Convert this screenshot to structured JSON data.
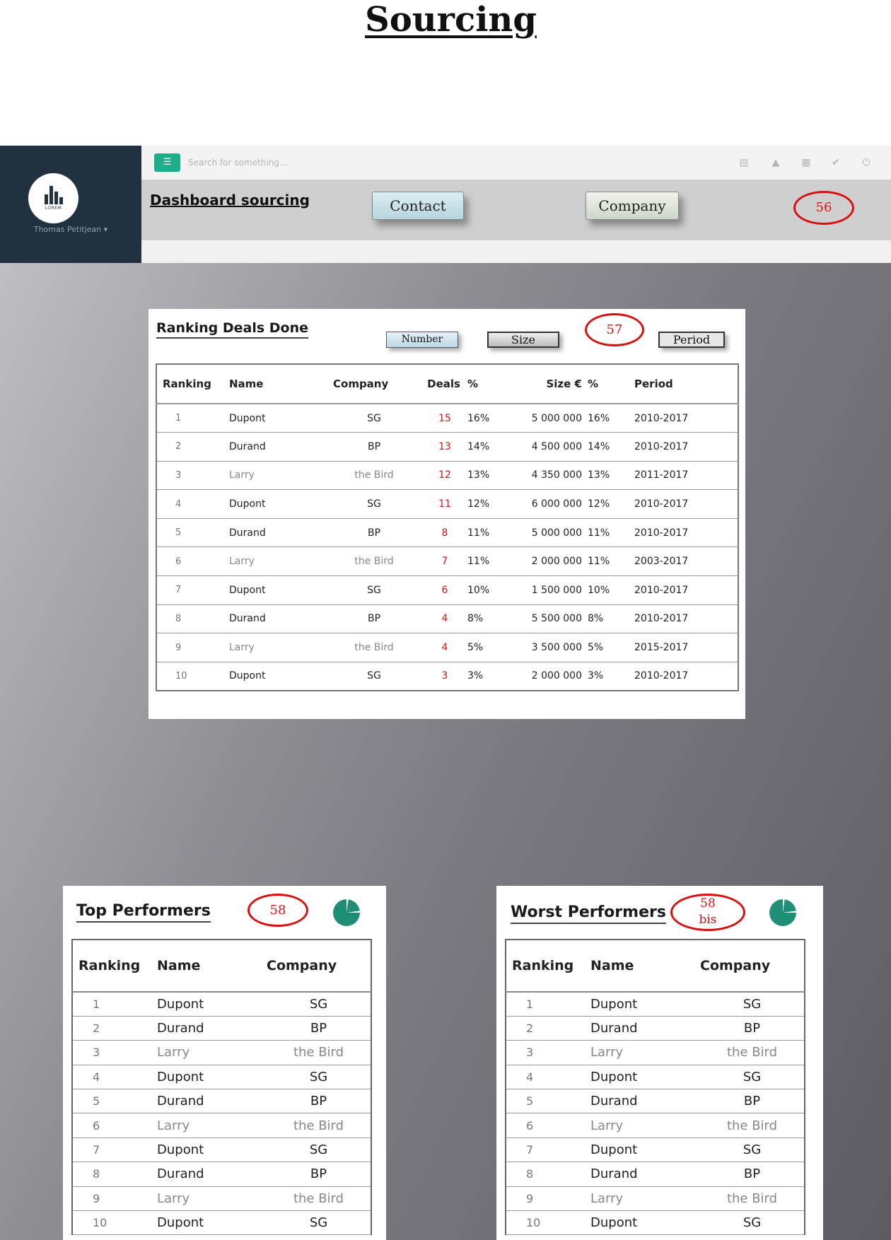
{
  "page_title": "Sourcing",
  "app": {
    "user_name": "Thomas Petitjean ▾",
    "logo_text": "LOREM",
    "search_placeholder": "Search for something...",
    "menu_icon": "hamburger-icon",
    "top_icons": [
      "document-icon",
      "user-icon",
      "calendar-icon",
      "check-icon",
      "power-icon"
    ]
  },
  "header": {
    "title": "Dashboard sourcing",
    "contact_label": "Contact",
    "company_label": "Company",
    "annotation": "56"
  },
  "ranking": {
    "title": "Ranking Deals Done",
    "buttons": {
      "number": "Number",
      "size": "Size",
      "period": "Period"
    },
    "annotation": "57",
    "columns": [
      "Ranking",
      "Name",
      "Company",
      "Deals",
      "%",
      "Size  €",
      "%",
      "Period"
    ],
    "rows": [
      {
        "rank": "1",
        "name": "Dupont",
        "company": "SG",
        "deals": "15",
        "deals_pct": "16%",
        "size": "5 000 000",
        "size_pct": "16%",
        "period": "2010-2017"
      },
      {
        "rank": "2",
        "name": "Durand",
        "company": "BP",
        "deals": "13",
        "deals_pct": "14%",
        "size": "4 500 000",
        "size_pct": "14%",
        "period": "2010-2017"
      },
      {
        "rank": "3",
        "name": "Larry",
        "company": "the Bird",
        "deals": "12",
        "deals_pct": "13%",
        "size": "4 350 000",
        "size_pct": "13%",
        "period": "2011-2017"
      },
      {
        "rank": "4",
        "name": "Dupont",
        "company": "SG",
        "deals": "11",
        "deals_pct": "12%",
        "size": "6 000 000",
        "size_pct": "12%",
        "period": "2010-2017"
      },
      {
        "rank": "5",
        "name": "Durand",
        "company": "BP",
        "deals": "8",
        "deals_pct": "11%",
        "size": "5 000 000",
        "size_pct": "11%",
        "period": "2010-2017"
      },
      {
        "rank": "6",
        "name": "Larry",
        "company": "the Bird",
        "deals": "7",
        "deals_pct": "11%",
        "size": "2 000 000",
        "size_pct": "11%",
        "period": "2003-2017"
      },
      {
        "rank": "7",
        "name": "Dupont",
        "company": "SG",
        "deals": "6",
        "deals_pct": "10%",
        "size": "1 500 000",
        "size_pct": "10%",
        "period": "2010-2017"
      },
      {
        "rank": "8",
        "name": "Durand",
        "company": "BP",
        "deals": "4",
        "deals_pct": "8%",
        "size": "5 500 000",
        "size_pct": "8%",
        "period": "2010-2017"
      },
      {
        "rank": "9",
        "name": "Larry",
        "company": "the Bird",
        "deals": "4",
        "deals_pct": "5%",
        "size": "3 500 000",
        "size_pct": "5%",
        "period": "2015-2017"
      },
      {
        "rank": "10",
        "name": "Dupont",
        "company": "SG",
        "deals": "3",
        "deals_pct": "3%",
        "size": "2 000 000",
        "size_pct": "3%",
        "period": "2010-2017"
      }
    ]
  },
  "top_performers": {
    "title": "Top Performers",
    "annotation": "58",
    "columns": [
      "Ranking",
      "Name",
      "Company"
    ],
    "rows": [
      {
        "rank": "1",
        "name": "Dupont",
        "company": "SG"
      },
      {
        "rank": "2",
        "name": "Durand",
        "company": "BP"
      },
      {
        "rank": "3",
        "name": "Larry",
        "company": "the Bird"
      },
      {
        "rank": "4",
        "name": "Dupont",
        "company": "SG"
      },
      {
        "rank": "5",
        "name": "Durand",
        "company": "BP"
      },
      {
        "rank": "6",
        "name": "Larry",
        "company": "the Bird"
      },
      {
        "rank": "7",
        "name": "Dupont",
        "company": "SG"
      },
      {
        "rank": "8",
        "name": "Durand",
        "company": "BP"
      },
      {
        "rank": "9",
        "name": "Larry",
        "company": "the Bird"
      },
      {
        "rank": "10",
        "name": "Dupont",
        "company": "SG"
      }
    ]
  },
  "worst_performers": {
    "title": "Worst Performers",
    "annotation_line1": "58",
    "annotation_line2": "bis",
    "columns": [
      "Ranking",
      "Name",
      "Company"
    ],
    "rows": [
      {
        "rank": "1",
        "name": "Dupont",
        "company": "SG"
      },
      {
        "rank": "2",
        "name": "Durand",
        "company": "BP"
      },
      {
        "rank": "3",
        "name": "Larry",
        "company": "the Bird"
      },
      {
        "rank": "4",
        "name": "Dupont",
        "company": "SG"
      },
      {
        "rank": "5",
        "name": "Durand",
        "company": "BP"
      },
      {
        "rank": "6",
        "name": "Larry",
        "company": "the Bird"
      },
      {
        "rank": "7",
        "name": "Dupont",
        "company": "SG"
      },
      {
        "rank": "8",
        "name": "Durand",
        "company": "BP"
      },
      {
        "rank": "9",
        "name": "Larry",
        "company": "the Bird"
      },
      {
        "rank": "10",
        "name": "Dupont",
        "company": "SG"
      }
    ]
  },
  "colors": {
    "sidebar": "#22313f",
    "accent": "#1fae8a",
    "annotation": "#d90f0f",
    "pie": "#1e8f74"
  }
}
